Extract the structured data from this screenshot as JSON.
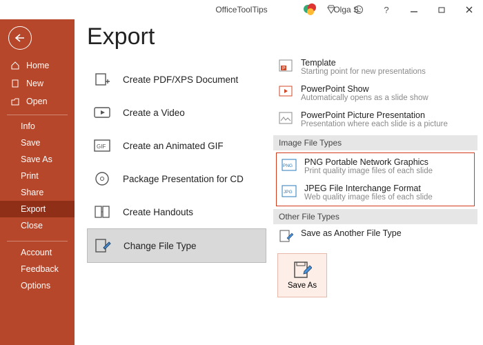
{
  "titlebar": {
    "document": "OfficeToolTips",
    "user": "Olga S"
  },
  "sidebar": {
    "home": "Home",
    "new": "New",
    "open": "Open",
    "subs": [
      "Info",
      "Save",
      "Save As",
      "Print",
      "Share",
      "Export",
      "Close"
    ],
    "bottom": [
      "Account",
      "Feedback",
      "Options"
    ]
  },
  "page": {
    "title": "Export"
  },
  "exportOptions": [
    {
      "label": "Create PDF/XPS Document"
    },
    {
      "label": "Create a Video"
    },
    {
      "label": "Create an Animated GIF"
    },
    {
      "label": "Package Presentation for CD"
    },
    {
      "label": "Create Handouts"
    },
    {
      "label": "Change File Type"
    }
  ],
  "fileTypes": {
    "top": [
      {
        "title": "Template",
        "desc": "Starting point for new presentations",
        "badge": "P",
        "badgeColor": "#d24726"
      },
      {
        "title": "PowerPoint Show",
        "desc": "Automatically opens as a slide show",
        "badge": "P",
        "badgeColor": "#d24726"
      },
      {
        "title": "PowerPoint Picture Presentation",
        "desc": "Presentation where each slide is a picture",
        "badge": "",
        "badgeColor": "#8a8a8a"
      }
    ],
    "imageHdr": "Image File Types",
    "image": [
      {
        "title": "PNG Portable Network Graphics",
        "desc": "Print quality image files of each slide",
        "badge": "PNG"
      },
      {
        "title": "JPEG File Interchange Format",
        "desc": "Web quality image files of each slide",
        "badge": "JPG"
      }
    ],
    "otherHdr": "Other File Types",
    "other": {
      "title": "Save as Another File Type"
    },
    "saveAs": "Save As"
  }
}
